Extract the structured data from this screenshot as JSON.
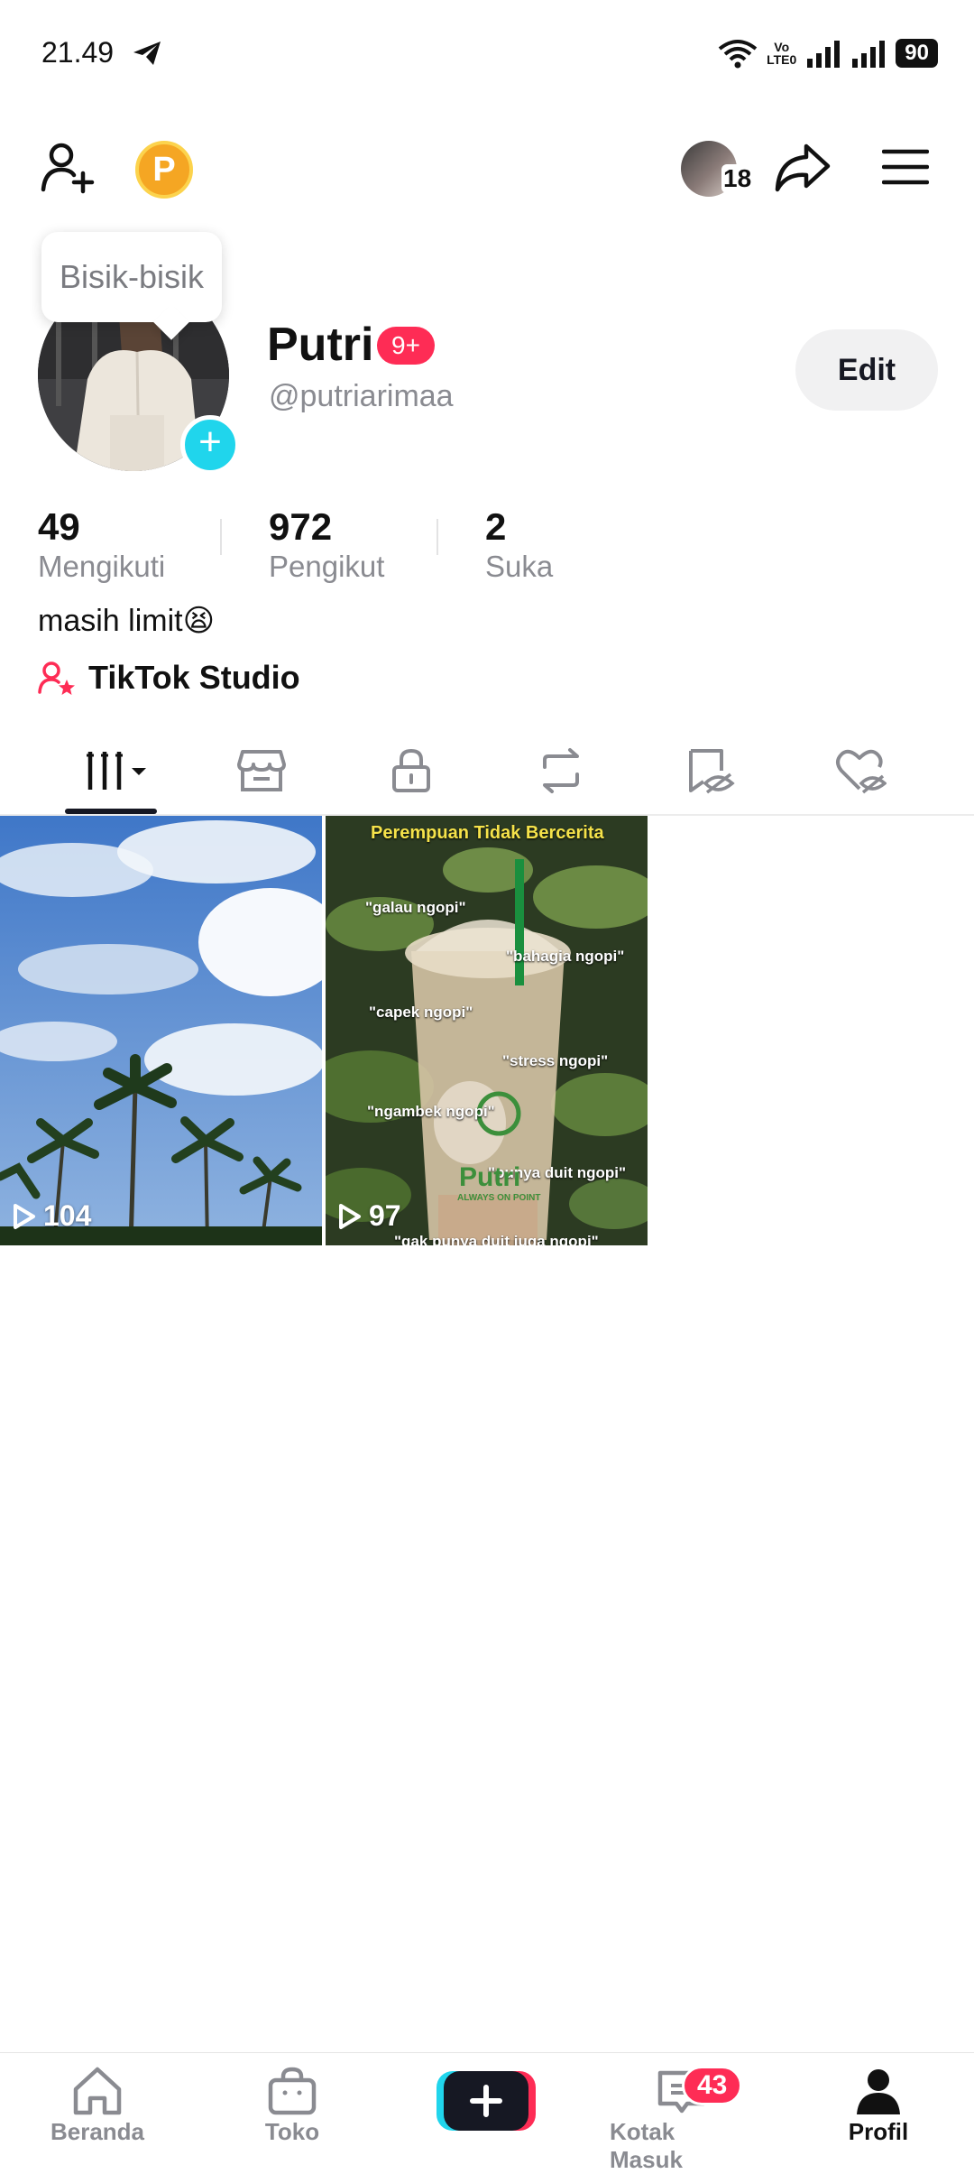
{
  "status_bar": {
    "time": "21.49",
    "volte_top": "Vo",
    "volte_bottom": "LTE0",
    "battery": "90"
  },
  "top_bar": {
    "coin_letter": "P",
    "friends_count": "18"
  },
  "profile": {
    "bubble_text": "Bisik-bisik",
    "name": "Putri",
    "badge": "9+",
    "username": "@putriarimaa",
    "edit_label": "Edit"
  },
  "stats": [
    {
      "value": "49",
      "label": "Mengikuti"
    },
    {
      "value": "972",
      "label": "Pengikut"
    },
    {
      "value": "2",
      "label": "Suka"
    }
  ],
  "bio": "masih limit😫",
  "studio_label": "TikTok Studio",
  "tabs": [
    "videos-icon",
    "shop-icon",
    "lock-icon",
    "repost-icon",
    "hidden-icon",
    "liked-icon"
  ],
  "videos": [
    {
      "views": "104"
    },
    {
      "views": "97",
      "title": "Perempuan Tidak Bercerita",
      "captions": [
        "\"galau ngopi\"",
        "\"bahagia ngopi\"",
        "\"capek ngopi\"",
        "\"stress ngopi\"",
        "\"ngambek ngopi\"",
        "\"punya duit ngopi\"",
        "\"gak punya duit juga ngopi\""
      ],
      "cup_brand": "Putri",
      "cup_tagline": "ALWAYS ON POINT"
    }
  ],
  "bottom_nav": {
    "home": "Beranda",
    "shop": "Toko",
    "inbox": "Kotak Masuk",
    "inbox_badge": "43",
    "profile": "Profil"
  },
  "colors": {
    "accent": "#fe2c55",
    "cyan": "#20d5ec",
    "coin": "#f5a623"
  }
}
